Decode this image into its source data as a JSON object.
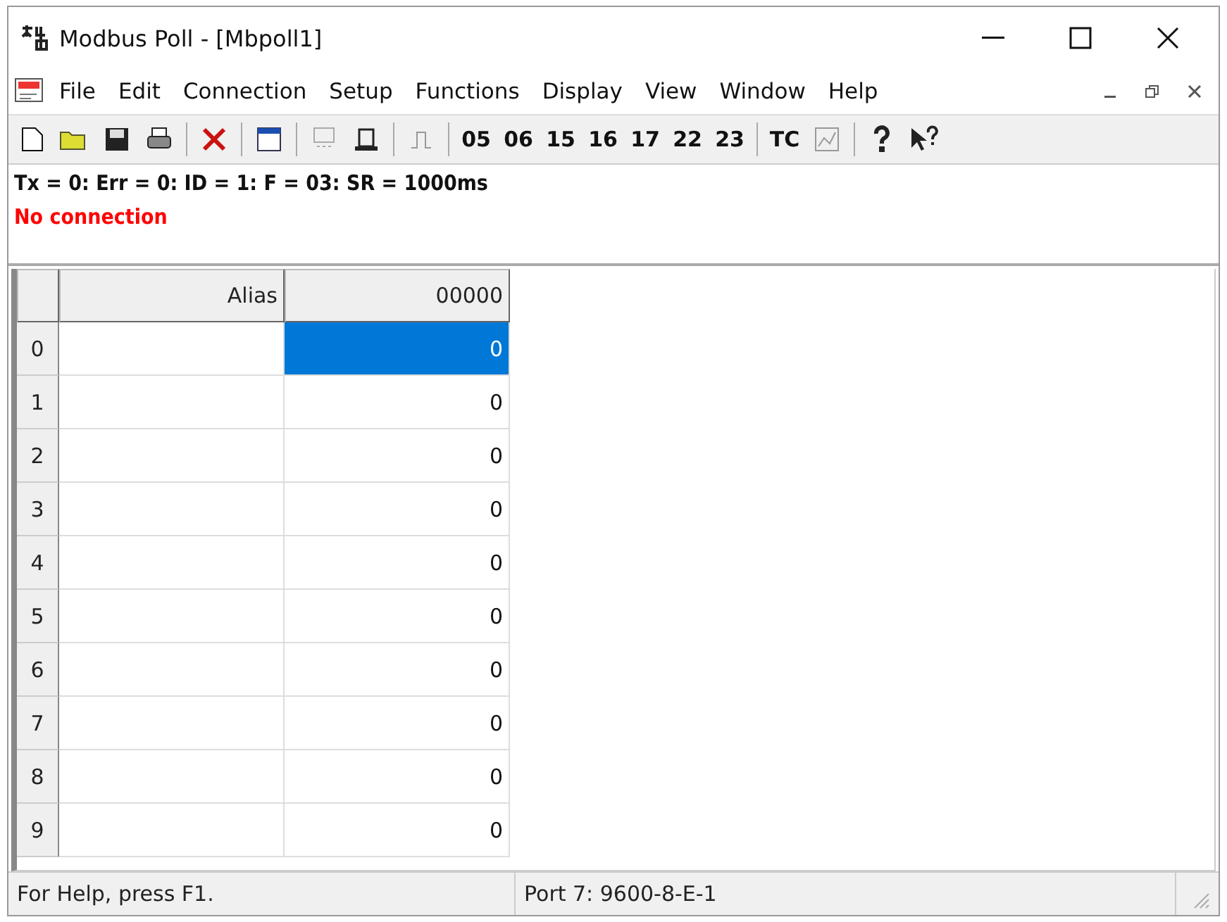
{
  "window": {
    "title": "Modbus Poll - [Mbpoll1]"
  },
  "menu": [
    "File",
    "Edit",
    "Connection",
    "Setup",
    "Functions",
    "Display",
    "View",
    "Window",
    "Help"
  ],
  "toolbar": {
    "function_codes": [
      "05",
      "06",
      "15",
      "16",
      "17",
      "22",
      "23"
    ],
    "tc": "TC"
  },
  "info": {
    "status_line": "Tx = 0: Err = 0: ID = 1: F = 03: SR = 1000ms",
    "connection": "No connection"
  },
  "table": {
    "columns": [
      "Alias",
      "00000"
    ],
    "rows": [
      {
        "index": "0",
        "alias": "",
        "value": "0",
        "selected": true
      },
      {
        "index": "1",
        "alias": "",
        "value": "0",
        "selected": false
      },
      {
        "index": "2",
        "alias": "",
        "value": "0",
        "selected": false
      },
      {
        "index": "3",
        "alias": "",
        "value": "0",
        "selected": false
      },
      {
        "index": "4",
        "alias": "",
        "value": "0",
        "selected": false
      },
      {
        "index": "5",
        "alias": "",
        "value": "0",
        "selected": false
      },
      {
        "index": "6",
        "alias": "",
        "value": "0",
        "selected": false
      },
      {
        "index": "7",
        "alias": "",
        "value": "0",
        "selected": false
      },
      {
        "index": "8",
        "alias": "",
        "value": "0",
        "selected": false
      },
      {
        "index": "9",
        "alias": "",
        "value": "0",
        "selected": false
      }
    ]
  },
  "status_bar": {
    "help": "For Help, press F1.",
    "port": "Port 7: 9600-8-E-1"
  }
}
